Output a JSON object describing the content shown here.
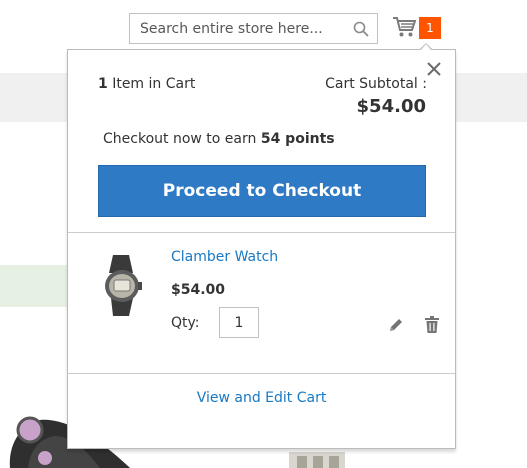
{
  "header": {
    "search": {
      "placeholder": "Search entire store here...",
      "value": ""
    },
    "cart": {
      "counter": "1"
    }
  },
  "minicart": {
    "items_count": "1",
    "items_label": "Item in Cart",
    "subtotal_label": "Cart Subtotal :",
    "subtotal_price": "$54.00",
    "earn_prefix": "Checkout now to earn",
    "earn_points": "54 points",
    "checkout_label": "Proceed to Checkout",
    "item": {
      "name": "Clamber Watch",
      "price": "$54.00",
      "qty_label": "Qty:",
      "qty_value": "1"
    },
    "view_edit_label": "View and Edit Cart"
  },
  "colors": {
    "accent": "#2e7ac4",
    "link": "#1979c3",
    "counter": "#ff5501"
  }
}
